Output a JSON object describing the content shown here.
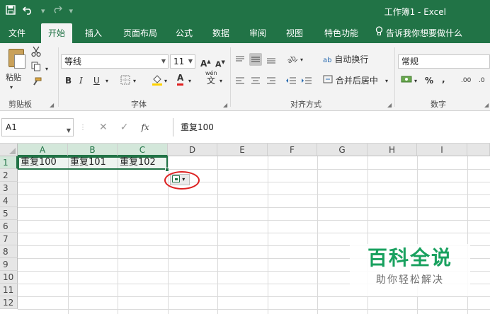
{
  "titlebar": {
    "title": "工作簿1  -  Excel",
    "save_icon": "save-icon",
    "undo_icon": "undo-icon",
    "redo_icon": "redo-icon"
  },
  "tabs": [
    {
      "label": "文件"
    },
    {
      "label": "开始"
    },
    {
      "label": "插入"
    },
    {
      "label": "页面布局"
    },
    {
      "label": "公式"
    },
    {
      "label": "数据"
    },
    {
      "label": "审阅"
    },
    {
      "label": "视图"
    },
    {
      "label": "特色功能"
    }
  ],
  "tellme": {
    "label": "告诉我你想要做什么"
  },
  "ribbon": {
    "clipboard": {
      "paste_label": "粘贴",
      "group_label": "剪贴板"
    },
    "font": {
      "font_name": "等线",
      "font_size": "11",
      "grow": "A",
      "shrink": "A",
      "bold": "B",
      "italic": "I",
      "underline": "U",
      "font_color_glyph": "A",
      "wen": "wén",
      "wen_char": "文",
      "group_label": "字体"
    },
    "alignment": {
      "wrap": "自动换行",
      "merge": "合并后居中",
      "wrap_icon_text": "ab",
      "group_label": "对齐方式"
    },
    "number": {
      "format": "常规",
      "percent": "%",
      "comma": ",",
      "inc_dec": ".00",
      "dec_dec": ".0",
      "group_label": "数字"
    }
  },
  "formulabar": {
    "namebox": "A1",
    "cancel": "✕",
    "enter": "✓",
    "fx": "fx",
    "content": "重复100"
  },
  "grid": {
    "columns": [
      "A",
      "B",
      "C",
      "D",
      "E",
      "F",
      "G",
      "H",
      "I"
    ],
    "rows": [
      "1",
      "2",
      "3",
      "4",
      "5",
      "6",
      "7",
      "8",
      "9",
      "10",
      "11",
      "12"
    ],
    "cells": {
      "A1": "重复100",
      "B1": "重复101",
      "C1": "重复102"
    }
  },
  "watermark": {
    "title": "百科全说",
    "subtitle": "助你轻松解决"
  },
  "colors": {
    "accent": "#217346",
    "highlight_circle": "#dd2222",
    "watermark": "#19a15f"
  }
}
